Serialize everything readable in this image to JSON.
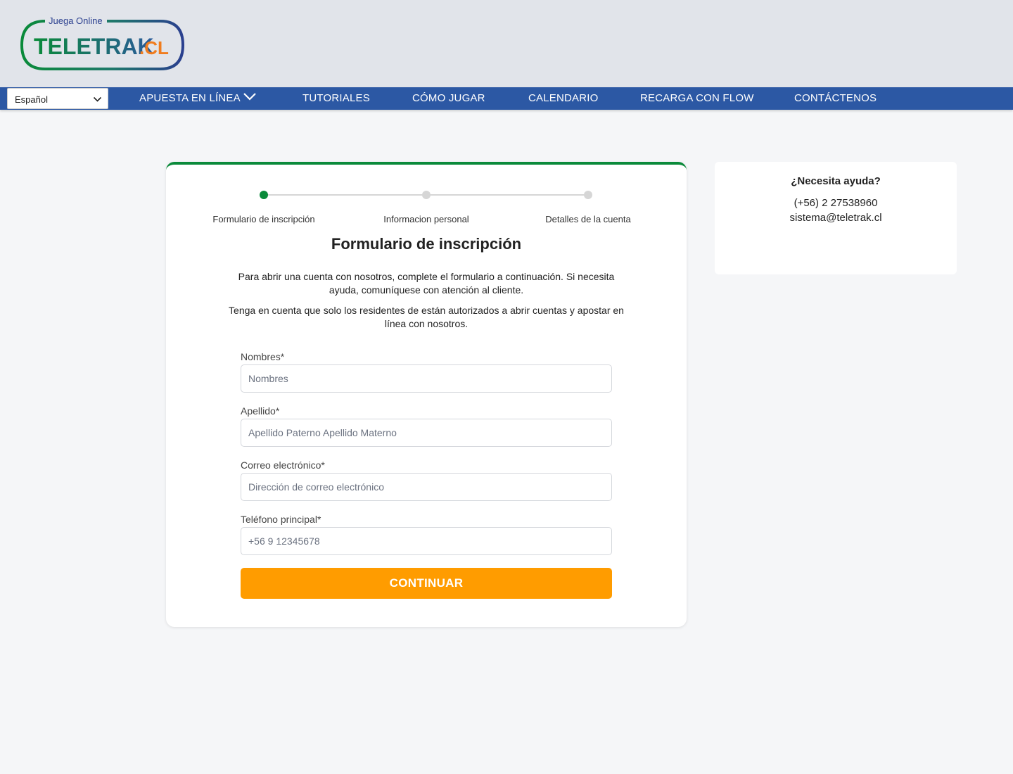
{
  "brand": {
    "tagline": "Juega Online",
    "name": "TELETRAK",
    "suffix": ".CL",
    "colors": {
      "green": "#0a8a3a",
      "blue": "#2a3f8f",
      "orange": "#f07c1e"
    }
  },
  "nav": {
    "language": "Español",
    "items": [
      {
        "label": "APUESTA EN LÍNEA",
        "has_dropdown": true
      },
      {
        "label": "TUTORIALES"
      },
      {
        "label": "CÓMO JUGAR"
      },
      {
        "label": "CALENDARIO"
      },
      {
        "label": "RECARGA CON FLOW"
      },
      {
        "label": "CONTÁCTENOS"
      }
    ],
    "bar_color": "#2c58a4"
  },
  "stepper": {
    "steps": [
      {
        "label": "Formulario de inscripción",
        "active": true
      },
      {
        "label": "Informacion personal",
        "active": false
      },
      {
        "label": "Detalles de la cuenta",
        "active": false
      }
    ],
    "active_color": "#0a8a3a"
  },
  "form": {
    "title": "Formulario de inscripción",
    "intro_1": "Para abrir una cuenta con nosotros, complete el formulario a continuación. Si necesita ayuda, comuníquese con atención al cliente.",
    "intro_2": "Tenga en cuenta que solo los residentes de están autorizados a abrir cuentas y apostar en línea con nosotros.",
    "fields": [
      {
        "label": "Nombres*",
        "placeholder": "Nombres",
        "value": ""
      },
      {
        "label": "Apellido*",
        "placeholder": "Apellido Paterno Apellido Materno",
        "value": ""
      },
      {
        "label": "Correo electrónico*",
        "placeholder": "Dirección de correo electrónico",
        "value": ""
      },
      {
        "label": "Teléfono principal*",
        "placeholder": "+56 9 12345678",
        "value": ""
      }
    ],
    "submit_label": "CONTINUAR",
    "submit_color": "#ff9c00"
  },
  "help": {
    "title": "¿Necesita ayuda?",
    "phone": "(+56) 2 27538960",
    "email": "sistema@teletrak.cl"
  }
}
